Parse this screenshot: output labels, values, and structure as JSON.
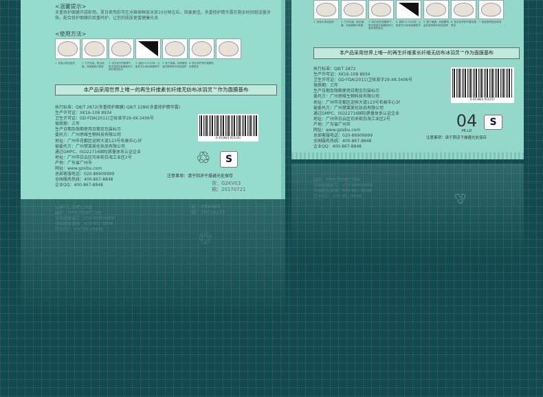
{
  "left_box": {
    "tips_title": "<温馨提示>",
    "tips_text": "多重修护面膜开袋即用。夏日使用前可在冰箱保鲜层冰放10分钟左右，效果更佳。多重修护精华露在剩余时间取适量涂抹，配合修护面膜的双重呵护，让您的肌肤更富健康光泽",
    "usage_title": "<使用方法>",
    "steps": [
      "1. 用温水清洁肌肤",
      "2. 打开包装，取出面膜，将面膜展平覆盖",
      "3. 将白色外层膜揭下，再手指轻压面膜使其与肌肤紧密贴合",
      "4. 面贴15-20分钟，让肌肤充分吸收面膜精华",
      "5. 取下面膜，将面膜残留的营养精华轻轻按摩",
      "6. 配合修护精华露敷贴效果更佳"
    ],
    "banner": "本产品采用世界上唯一的再生纤维素长纤维无纺布冰羽灵™作为面膜基布",
    "info": [
      "执行标准：Q8/T 2872(多重修护面膜)    Q8/T 2286(多重修护精华露)",
      "生产许可证：XK16-108 8934",
      "卫生许可证：GD·FDA(2011)卫妆准字29-XK-3406号",
      "保质期：三年",
      "生产日期及限期使用日期见包装标示",
      "委托方：广州思唯生物科技有限公司",
      "地址：广州市花都区迎宾大道123号名高中心3F",
      "被委托方：广州黛莱美化妆品有限公司",
      "通过GMPC、ISO22716国际质量体系认证企业",
      "地址：广州市白云区均禾街白海工业区2号",
      "产地：广东省广州市",
      "网址：www.gzsibu.com",
      "总部客服电话：020-86909999",
      "全国服务热线：400-867-8848",
      "企业QQ：400-867-8848"
    ],
    "barcode_number": "6 953683 955140",
    "recycle_symbol": "♲",
    "quality_symbol": "S",
    "note": "注意事项：请于阴凉干燥避光处保存",
    "codes": [
      "货：G2KV03",
      "期：20170721"
    ]
  },
  "right_packet": {
    "steps": [
      "1. 用温水清洁肌肤",
      "2. 打开包装，取出面膜，将面膜展平覆盖",
      "3. 将白色外层膜揭下，再手指轻压面膜使其与肌肤紧密贴合",
      "4. 面贴15-20分钟，让肌肤充分吸收面膜精华",
      "5. 取下面膜，将面膜残留的营养精华轻轻按摩",
      "6. 配合修护精华露效果更佳",
      "7. 轻轻按摩直至吸收"
    ],
    "banner": "本产品采用世界上唯一的再生纤维素长纤维无纺布冰羽灵™作为面膜基布",
    "info": [
      "执行标准：Q8/T 2872",
      "生产许可证：XK16-108 8934",
      "卫生许可证：GD·FDA(2011)卫妆准字29-XK-3406号",
      "保质期：三年",
      "生产日期及限期使用日期见包装标示",
      "委托方：广州思唯生物科技有限公司",
      "地址：广州市花都区迎宾大道123号名高中心3F",
      "被委托方：广州黛莱美化妆品有限公司",
      "通过GMPC、ISO22716国际质量体系认证企业",
      "地址：广州市白云区均禾街白海工业区2号",
      "产地：广东省广州市",
      "网址：www.gzsibu.com",
      "总部客服电话：020-86909999",
      "全国服务热线：400-867-8848",
      "企业QQ：400-867-8848"
    ],
    "barcode_number": "6 953683 955157",
    "recycle_code": "04",
    "recycle_label": "PE-LD",
    "quality_symbol": "S",
    "note": "注意事项：请于阴凉干燥避光处保存"
  }
}
